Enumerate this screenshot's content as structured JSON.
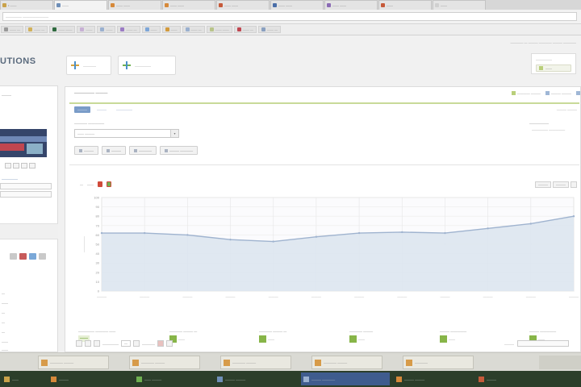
{
  "browser": {
    "tabs": [
      {
        "title": "• ——",
        "color": "#c9a24a",
        "active": false
      },
      {
        "title": "——",
        "color": "#6f8fb8",
        "active": true
      },
      {
        "title": "—— ——",
        "color": "#d6893a",
        "active": false
      },
      {
        "title": "—— ——",
        "color": "#d6893a",
        "active": false
      },
      {
        "title": "—— ——",
        "color": "#c65a3a",
        "active": false
      },
      {
        "title": "—— ——",
        "color": "#4a6ea8",
        "active": false
      },
      {
        "title": "—— ——",
        "color": "#8b6bb5",
        "active": false
      },
      {
        "title": "——",
        "color": "#c65a3a",
        "active": false
      },
      {
        "title": "——",
        "color": "#d0d0d0",
        "active": false
      }
    ],
    "url": "————— ————————",
    "bookmarks": [
      {
        "label": "—— —",
        "color": "#999"
      },
      {
        "label": "—— —",
        "color": "#d1b15a"
      },
      {
        "label": "—— ——",
        "color": "#2f6a3f"
      },
      {
        "label": "——",
        "color": "#c7b0d4"
      },
      {
        "label": "——",
        "color": "#9ab0cf"
      },
      {
        "label": "—— —",
        "color": "#9b7bc4"
      },
      {
        "label": "——",
        "color": "#7da6d8"
      },
      {
        "label": "——",
        "color": "#d39a3c"
      },
      {
        "label": "—— —",
        "color": "#9ab0cf"
      },
      {
        "label": "—— ——",
        "color": "#b8c48a"
      },
      {
        "label": "—— —",
        "color": "#c04650"
      },
      {
        "label": "—— —",
        "color": "#8aa0c0"
      }
    ]
  },
  "header": {
    "logo": "UTIONS",
    "top_links": "———— — ——— ———— ——— ————",
    "boxes": [
      {
        "label": "————"
      },
      {
        "label": "—————"
      }
    ],
    "user": {
      "label": "—————",
      "button": "——"
    }
  },
  "sidebar": {
    "title": "———",
    "link": "—————",
    "items": [
      "—",
      "——",
      "—",
      "—",
      "—",
      "——",
      "——"
    ]
  },
  "main": {
    "title": "————— ———",
    "actions": [
      "———— ———",
      "——— ———"
    ],
    "subtabs": [
      "———",
      "———",
      "—————"
    ],
    "subtab_right": "——— ———",
    "filter_label": "———— —————",
    "filter_value": "—— ———",
    "filter_label2": "——————",
    "filter_value2": "————— —————",
    "buttons": [
      "———",
      "———",
      "————",
      "——— ————"
    ],
    "chart_tools": [
      "—",
      "——"
    ],
    "chart_right": [
      "———",
      "———"
    ],
    "stats": [
      {
        "name": "————— ———— ——",
        "value": "——",
        "big": true
      },
      {
        "name": "———— ——— —",
        "value": "——",
        "big": false
      },
      {
        "name": "———— ——— —",
        "value": "——",
        "big": false
      },
      {
        "name": "———— ———",
        "value": "——",
        "big": false
      },
      {
        "name": "——— —————",
        "value": "——",
        "big": false
      },
      {
        "name": "——— —————",
        "value": "——",
        "big": false
      }
    ],
    "pager": {
      "per_page": "—————",
      "page_value": "—",
      "of_label": "————",
      "right_label": "———"
    }
  },
  "chart_data": {
    "type": "area",
    "categories": [
      "———",
      "———",
      "———",
      "———",
      "———",
      "———",
      "———",
      "———",
      "———",
      "———",
      "———",
      "———"
    ],
    "x": [
      0,
      1,
      2,
      3,
      4,
      5,
      6,
      7,
      8,
      9,
      10,
      11
    ],
    "values": [
      62,
      62,
      60,
      55,
      53,
      58,
      62,
      63,
      62,
      67,
      72,
      80
    ],
    "ylim": [
      0,
      100
    ],
    "yticks": [
      "100",
      "90",
      "80",
      "70",
      "60",
      "50",
      "40",
      "30",
      "20",
      "10",
      "0"
    ],
    "ylabel": "—————",
    "grid": true,
    "fill_color": "#dde5f0",
    "line_color": "#9fb3cf"
  },
  "taskbar": {
    "upper": [
      {
        "label": "———— ———"
      },
      {
        "label": "———— ———"
      },
      {
        "label": "———— ———"
      },
      {
        "label": "———— ———"
      },
      {
        "label": "————"
      }
    ],
    "lower": [
      {
        "label": "——",
        "color": "#c9a24a",
        "active": false
      },
      {
        "label": "———",
        "color": "#d6893a",
        "active": false
      },
      {
        "label": "—— ———",
        "color": "#6fb050",
        "active": false
      },
      {
        "label": "——— ———",
        "color": "#6f8fb8",
        "active": false
      },
      {
        "label": "——— ————",
        "color": "#9ab0cf",
        "active": true
      },
      {
        "label": "——— ———",
        "color": "#d6893a",
        "active": false
      },
      {
        "label": "———",
        "color": "#c65a3a",
        "active": false
      }
    ]
  }
}
